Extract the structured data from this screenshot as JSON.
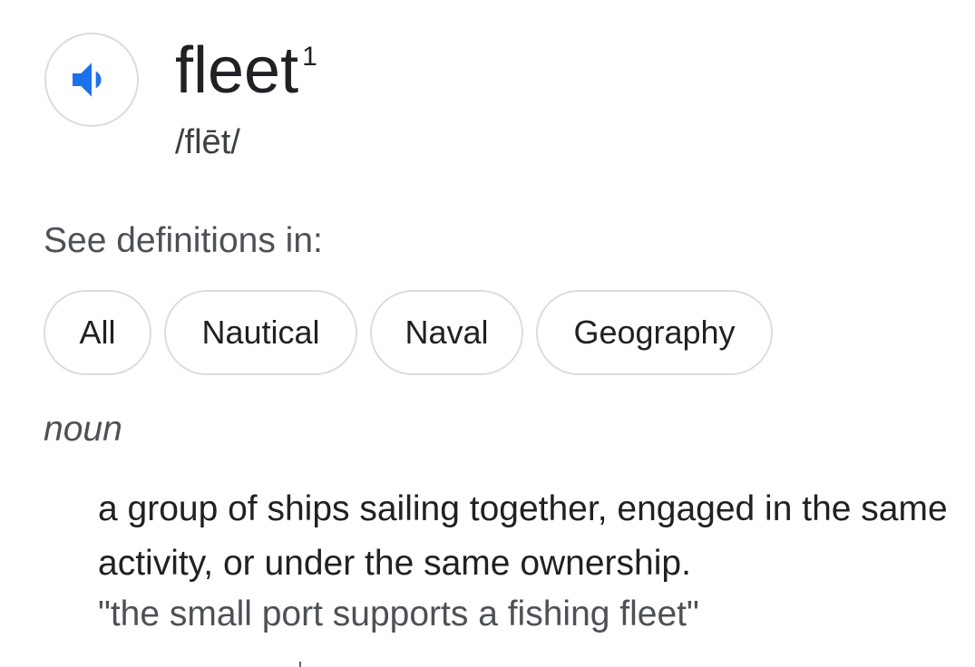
{
  "entry": {
    "word": "fleet",
    "sense_number": "1",
    "phonetic": "/flēt/",
    "audio_icon": "speaker-icon"
  },
  "definitions_filter": {
    "label": "See definitions in:",
    "chips": [
      "All",
      "Nautical",
      "Naval",
      "Geography"
    ]
  },
  "sense": {
    "part_of_speech": "noun",
    "definition": "a group of ships sailing together, engaged in the same activity, or under the same ownership.",
    "example": "\"the small port supports a fishing fleet\""
  },
  "colors": {
    "accent": "#1a73e8",
    "text": "#202124",
    "secondary_text": "#4d5156",
    "border": "#dadce0"
  }
}
